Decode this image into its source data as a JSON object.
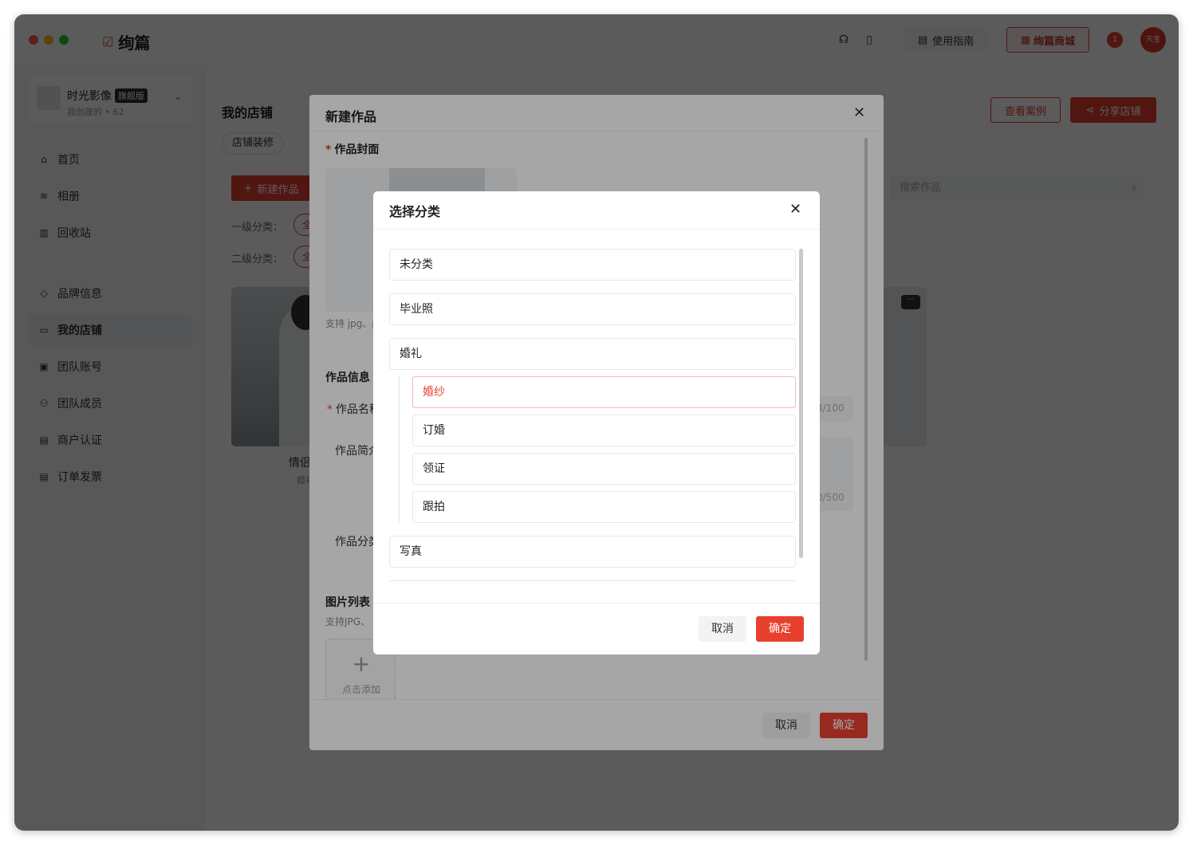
{
  "app": {
    "name": "绚篇",
    "guide_label": "使用指南",
    "mall_label": "绚篇商城",
    "badge_text": "1",
    "avatar_text": "天宝"
  },
  "sidebar": {
    "studio_name": "时光影像",
    "studio_tag": "旗舰版",
    "studio_sub": "我创建的 • 62",
    "items": [
      {
        "label": "首页",
        "icon": "home-icon"
      },
      {
        "label": "相册",
        "icon": "layers-icon"
      },
      {
        "label": "回收站",
        "icon": "trash-icon"
      },
      {
        "label": "品牌信息",
        "icon": "diamond-icon"
      },
      {
        "label": "我的店铺",
        "icon": "store-icon"
      },
      {
        "label": "团队账号",
        "icon": "account-icon"
      },
      {
        "label": "团队成员",
        "icon": "members-icon"
      },
      {
        "label": "商户认证",
        "icon": "certificate-icon"
      },
      {
        "label": "订单发票",
        "icon": "invoice-icon"
      }
    ]
  },
  "main": {
    "title": "我的店铺",
    "view_cases_label": "查看案例",
    "share_store_label": "分享店铺",
    "tab_decor": "店铺装修",
    "new_work_label": "新建作品",
    "filter1_label": "一级分类：",
    "filter2_label": "二级分类：",
    "filter_pill_text": "全",
    "search_placeholder": "搜索作品",
    "card_caption": "情侣",
    "card_sub": "婚礼"
  },
  "dialog1": {
    "title": "新建作品",
    "cover_label": "作品封面",
    "cover_hint": "支持 jpg、p",
    "info_label": "作品信息",
    "name_label": "作品名称",
    "name_counter": "4/100",
    "intro_label": "作品简介",
    "intro_counter": "0/500",
    "category_label": "作品分类",
    "images_label": "图片列表",
    "images_hint": "支持JPG、",
    "add_label": "点击添加",
    "cancel": "取消",
    "confirm": "确定"
  },
  "dialog2": {
    "title": "选择分类",
    "categories": [
      {
        "label": "未分类",
        "level": 1
      },
      {
        "label": "毕业照",
        "level": 1
      },
      {
        "label": "婚礼",
        "level": 1
      },
      {
        "label": "婚纱",
        "level": 2,
        "selected": true
      },
      {
        "label": "订婚",
        "level": 2
      },
      {
        "label": "领证",
        "level": 2
      },
      {
        "label": "跟拍",
        "level": 2
      },
      {
        "label": "写真",
        "level": 1
      }
    ],
    "cancel": "取消",
    "confirm": "确定"
  },
  "colors": {
    "accent": "#e8402f",
    "overlay": "#000000"
  }
}
